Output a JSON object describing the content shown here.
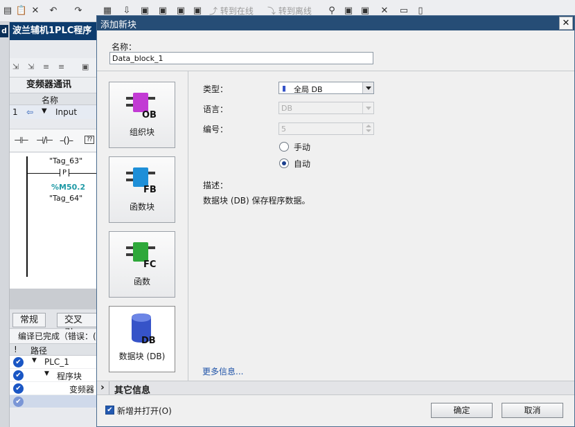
{
  "app": {
    "toolbar": {
      "go_online": "转到在线",
      "go_offline": "转到离线"
    },
    "project_title": "波兰辅机1PLC程序",
    "left_strip_mark": "d",
    "block_editor": {
      "block_title": "变频器通讯",
      "interface_header": {
        "no": "",
        "name": "名称"
      },
      "interface_row": {
        "no": "1",
        "name": "Input"
      },
      "ladder": {
        "tag_top": "\"Tag_63\"",
        "contact_label": "P",
        "address": "%M50.2",
        "tag_bottom": "\"Tag_64\"",
        "address_color": "#1f9aa6"
      }
    },
    "inspector": {
      "tabs": [
        "常规",
        "交叉引"
      ],
      "compile_status": "编译已完成（错误：(",
      "header": {
        "col1": "!",
        "col2": "路径"
      },
      "rows": [
        {
          "label": "PLC_1",
          "expand": "▼"
        },
        {
          "label": "程序块",
          "expand": "▼"
        },
        {
          "label": "变频器",
          "expand": ""
        },
        {
          "label": "",
          "expand": ""
        }
      ]
    }
  },
  "dialog": {
    "title": "添加新块",
    "name_label": "名称：",
    "name_value": "Data_block_1",
    "block_types": [
      {
        "id": "ob",
        "icon": "organization-block-icon",
        "badge": "OB",
        "color": "#c23bd4",
        "label": "组织块",
        "selected": false
      },
      {
        "id": "fb",
        "icon": "function-block-icon",
        "badge": "FB",
        "color": "#1e8fd8",
        "label": "函数块",
        "selected": false
      },
      {
        "id": "fc",
        "icon": "function-icon",
        "badge": "FC",
        "color": "#2ea83a",
        "label": "函数",
        "selected": false
      },
      {
        "id": "db",
        "icon": "data-block-icon",
        "badge": "DB",
        "color": "#3653c8",
        "label": "数据块 (DB)",
        "selected": true
      }
    ],
    "properties": {
      "type_label": "类型：",
      "type_value": "全局 DB",
      "language_label": "语言：",
      "language_value": "DB",
      "number_label": "编号：",
      "number_value": "5",
      "manual_label": "手动",
      "auto_label": "自动",
      "numbering_mode": "auto",
      "description_label": "描述：",
      "description_text": "数据块 (DB) 保存程序数据。",
      "more_info": "更多信息..."
    },
    "other_info": "其它信息",
    "add_and_open_label": "新增并打开(O)",
    "add_and_open_checked": true,
    "ok_button": "确定",
    "cancel_button": "取消",
    "close_symbol": "✕"
  }
}
